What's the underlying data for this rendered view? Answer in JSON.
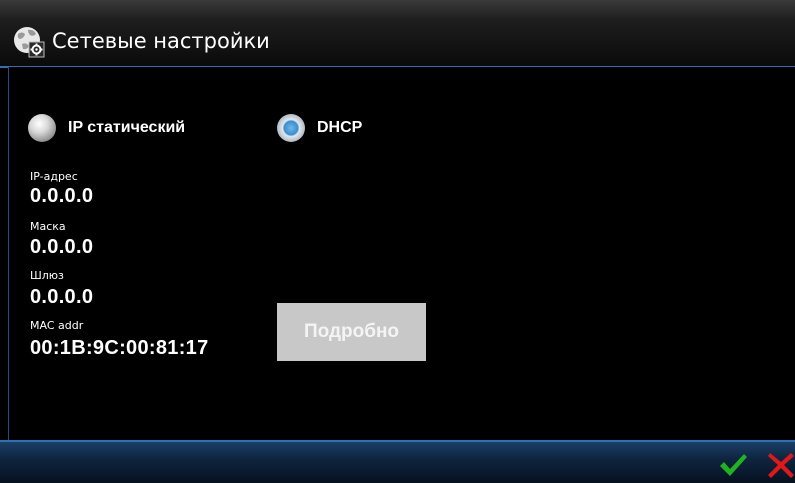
{
  "header": {
    "title": "Сетевые настройки",
    "icon": "network-settings-icon"
  },
  "mode": {
    "options": [
      {
        "label": "IP статический",
        "selected": false
      },
      {
        "label": "DHCP",
        "selected": true
      }
    ]
  },
  "fields": {
    "ip": {
      "label": "IP-адрес",
      "value": "0.0.0.0"
    },
    "mask": {
      "label": "Маска",
      "value": "0.0.0.0"
    },
    "gateway": {
      "label": "Шлюз",
      "value": "0.0.0.0"
    },
    "mac": {
      "label": "MAC addr",
      "value": "00:1B:9C:00:81:17"
    }
  },
  "details_button": {
    "label": "Подробно"
  },
  "footer": {
    "ok_icon": "checkmark-icon",
    "cancel_icon": "close-icon",
    "ok_color": "#1fb31f",
    "cancel_color": "#e01818"
  },
  "colors": {
    "accent": "#2f6fb3",
    "background": "#000000"
  }
}
